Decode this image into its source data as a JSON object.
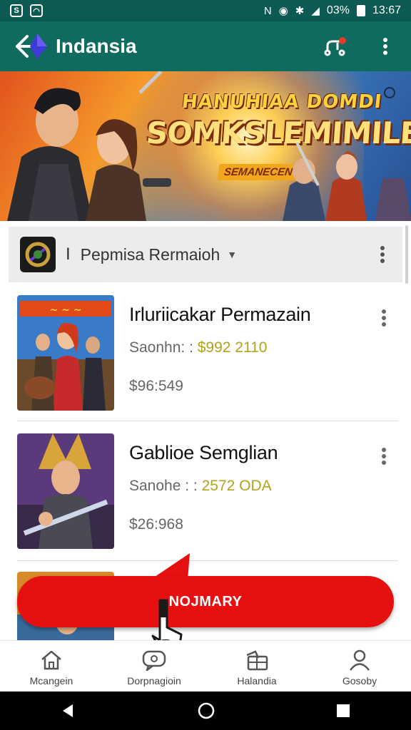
{
  "status_bar": {
    "battery_text": "03%",
    "time": "13:67"
  },
  "app_bar": {
    "title": "Indansia",
    "icons": [
      "back-arrow-icon",
      "share-network-icon",
      "overflow-menu-icon"
    ]
  },
  "banner": {
    "line1": "HANUHIAA DOMDI",
    "line2": "SOMKSLEMIMILES",
    "sub": "SEMANECEN"
  },
  "filter": {
    "separator": "I",
    "label": "Pepmisa Rermaioh"
  },
  "items": [
    {
      "title": "Irluriicakar Permazain",
      "sub_label": "Saonhn: :",
      "sub_value": "$992 2110",
      "price": "$96:549"
    },
    {
      "title": "Gablioe Semglian",
      "sub_label": "Sanohe : :",
      "sub_value": "2572 ODA",
      "price": "$26:968"
    }
  ],
  "cta": {
    "label": "NOJMARY"
  },
  "bottom_nav": [
    {
      "label": "Mcangein",
      "icon": "home-icon"
    },
    {
      "label": "Dorpnagioin",
      "icon": "chat-icon"
    },
    {
      "label": "Halandia",
      "icon": "wallet-icon"
    },
    {
      "label": "Gosoby",
      "icon": "person-icon"
    }
  ],
  "colors": {
    "app_bar": "#0e6b5e",
    "status_bar": "#0d5a52",
    "cta": "#e71010",
    "price_accent": "#b1a31a"
  }
}
